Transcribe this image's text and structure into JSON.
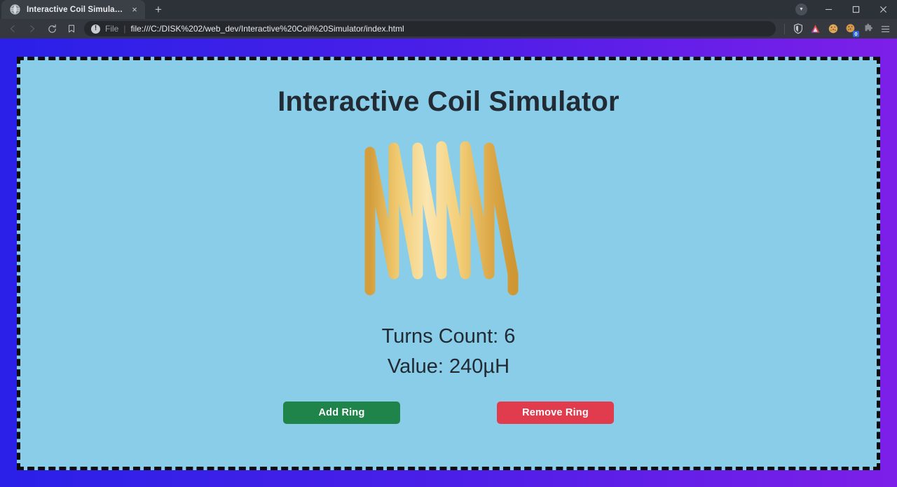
{
  "browser": {
    "tab": {
      "title": "Interactive Coil Simulator",
      "favicon": "globe-icon",
      "close_label": "×"
    },
    "newtab_label": "+",
    "window_controls": {
      "profile_label": "▼",
      "minimize_label": "–",
      "maximize_label": "☐",
      "close_label": "✕"
    },
    "omnibox": {
      "scheme_label": "File",
      "separator": "|",
      "url": "file:///C:/DISK%202/web_dev/Interactive%20Coil%20Simulator/index.html",
      "info_glyph": "!"
    },
    "nav": {
      "back": "back-icon",
      "forward": "forward-icon",
      "reload": "reload-icon",
      "bookmark": "bookmark-icon"
    },
    "toolbar_icons": [
      {
        "name": "brave-shields-icon"
      },
      {
        "name": "brave-rewards-icon"
      },
      {
        "name": "cookie-icon"
      },
      {
        "name": "cookie-blocked-icon",
        "badge": "0"
      },
      {
        "name": "extensions-puzzle-icon"
      },
      {
        "name": "menu-hamburger-icon"
      }
    ]
  },
  "page": {
    "title": "Interactive Coil Simulator",
    "turns_label": "Turns Count: 6",
    "value_label": "Value: 240µH",
    "add_button": "Add Ring",
    "remove_button": "Remove Ring",
    "colors": {
      "page_background": "#89cde9",
      "border": "#0d0d0d",
      "title_text": "#222a33",
      "add_button": "#1e8449",
      "remove_button": "#e03c4e",
      "coil_wire_light": "#fae3a8",
      "coil_wire_mid": "#f2cd72",
      "coil_wire_dark": "#d9a441",
      "backdrop_left": "#2a20e8",
      "backdrop_right": "#7d1fe8"
    },
    "coil": {
      "turns": 6,
      "strand_count": 7,
      "inductance_uH": 240
    }
  }
}
